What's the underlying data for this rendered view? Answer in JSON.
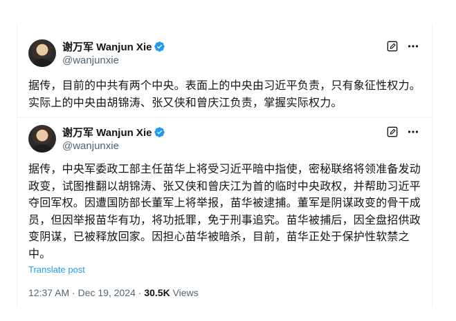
{
  "tweet1": {
    "author_name": "谢万军 Wanjun Xie",
    "handle": "@wanjunxie",
    "text": "据传，目前的中共有两个中央。表面上的中央由习近平负责，只有象征性权力。实际上的中央由胡锦涛、张又侠和曾庆江负责，掌握实际权力。",
    "icons": {
      "verified": "verified-badge-icon",
      "edit": "edit-icon",
      "more": "more-icon"
    }
  },
  "tweet2": {
    "author_name": "谢万军 Wanjun Xie",
    "handle": "@wanjunxie",
    "text": "据传，中央军委政工部主任苗华上将受习近平暗中指使，密秘联络将领准备发动政变，试图推翻以胡锦涛、张又侠和曾庆江为首的临时中央政权，并帮助习近平夺回军权。因遭国防部长董军上将举报，苗华被逮捕。董军是阴谋政变的骨干成员，但因举报苗华有功，将功抵罪，免于刑事追究。苗华被捕后，因全盘招供政变阴谋，已被释放回家。因担心苗华被暗杀，目前，苗华正处于保护性软禁之中。",
    "translate_label": "Translate post",
    "timestamp": "12:37 AM · Dec 19, 2024",
    "separator": " · ",
    "views_count": "30.5K",
    "views_label": " Views",
    "icons": {
      "verified": "verified-badge-icon",
      "edit": "edit-icon",
      "more": "more-icon"
    }
  },
  "colors": {
    "accent": "#1d9bf0",
    "text": "#0f1419",
    "secondary": "#536471",
    "divider": "#eff3f4"
  }
}
